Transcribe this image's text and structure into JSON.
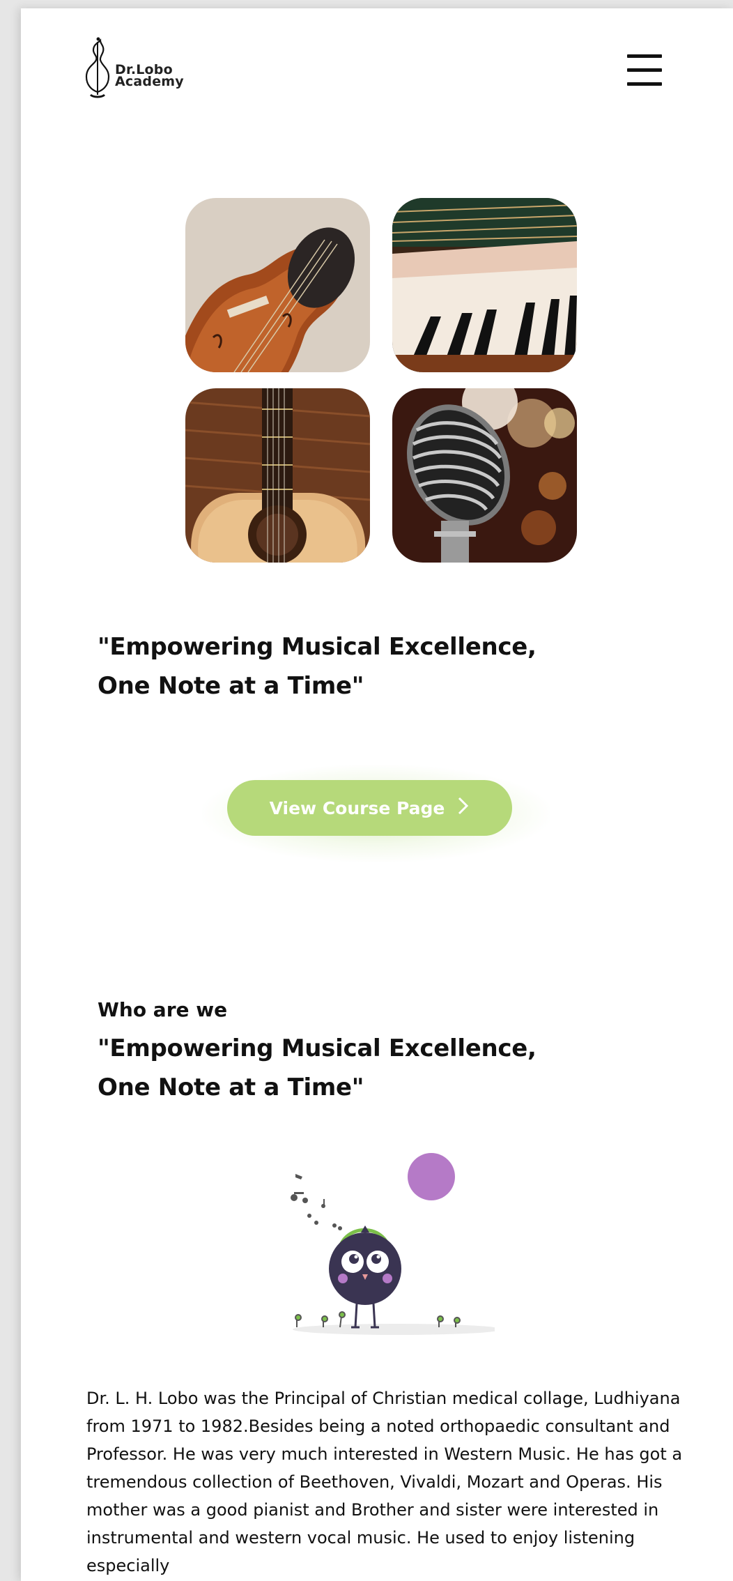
{
  "header": {
    "logo_line1": "Dr.Lobo",
    "logo_line2": "Academy",
    "menu_icon": "hamburger-menu-icon"
  },
  "gallery": [
    {
      "name": "violin-image"
    },
    {
      "name": "piano-keys-image"
    },
    {
      "name": "acoustic-guitar-image"
    },
    {
      "name": "vintage-microphone-image"
    }
  ],
  "hero": {
    "quote": "\"Empowering Musical Excellence,\nOne Note at a Time\"",
    "cta_label": "View Course Page",
    "cta_icon": "chevron-right-icon"
  },
  "about": {
    "eyebrow": "Who are we",
    "quote": "\"Empowering Musical Excellence,\nOne Note at a Time\"",
    "body": "Dr. L. H. Lobo was the Principal of Christian medical collage, Ludhiyana from 1971 to 1982.Besides being a noted orthopaedic consultant and Professor. He was very much interested in Western Music. He has got a tremendous collection of Beethoven, Vivaldi, Mozart and Operas. His mother was a good pianist and Brother and sister were interested in instrumental and western vocal music. He used to enjoy listening especially"
  },
  "colors": {
    "accent": "#b6d97a",
    "accent_purple": "#b57ac7",
    "bird": "#3a3452",
    "headphones": "#7cc04a"
  }
}
